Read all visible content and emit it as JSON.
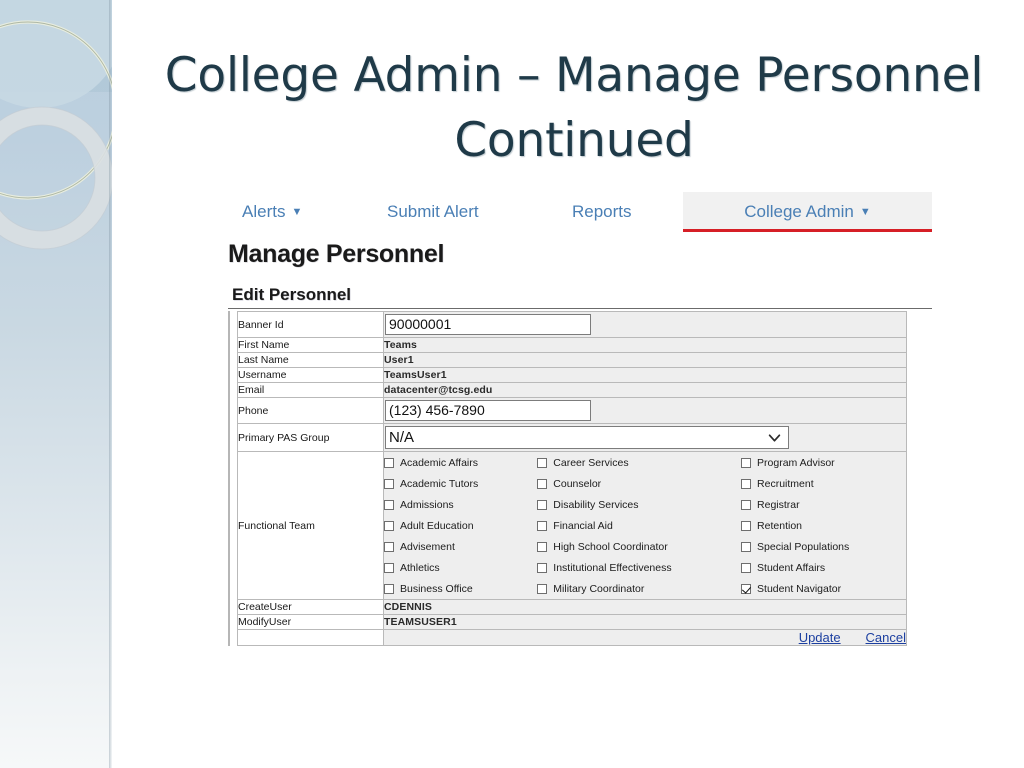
{
  "slide": {
    "title": "College Admin – Manage Personnel Continued"
  },
  "nav": {
    "items": [
      {
        "label": "Alerts",
        "has_caret": true,
        "active": false
      },
      {
        "label": "Submit Alert",
        "has_caret": false,
        "active": false
      },
      {
        "label": "Reports",
        "has_caret": false,
        "active": false
      },
      {
        "label": "College Admin",
        "has_caret": true,
        "active": true
      }
    ],
    "caret_glyph": "▼",
    "active_underline_color": "#d61f26",
    "link_color": "#4a7fb5"
  },
  "page": {
    "heading": "Manage Personnel"
  },
  "panel": {
    "header": "Edit Personnel",
    "fields": [
      {
        "label": "Banner Id",
        "value": "90000001",
        "type": "text"
      },
      {
        "label": "First Name",
        "value": "Teams",
        "type": "static"
      },
      {
        "label": "Last Name",
        "value": "User1",
        "type": "static"
      },
      {
        "label": "Username",
        "value": "TeamsUser1",
        "type": "static"
      },
      {
        "label": "Email",
        "value": "datacenter@tcsg.edu",
        "type": "static"
      },
      {
        "label": "Phone",
        "value": "(123) 456-7890",
        "type": "text"
      },
      {
        "label": "Primary PAS Group",
        "value": "N/A",
        "type": "select"
      }
    ],
    "functional_team": {
      "label": "Functional Team",
      "columns": [
        [
          {
            "label": "Academic Affairs",
            "checked": false
          },
          {
            "label": "Academic Tutors",
            "checked": false
          },
          {
            "label": "Admissions",
            "checked": false
          },
          {
            "label": "Adult Education",
            "checked": false
          },
          {
            "label": "Advisement",
            "checked": false
          },
          {
            "label": "Athletics",
            "checked": false
          },
          {
            "label": "Business Office",
            "checked": false
          }
        ],
        [
          {
            "label": "Career Services",
            "checked": false
          },
          {
            "label": "Counselor",
            "checked": false
          },
          {
            "label": "Disability Services",
            "checked": false
          },
          {
            "label": "Financial Aid",
            "checked": false
          },
          {
            "label": "High School Coordinator",
            "checked": false
          },
          {
            "label": "Institutional Effectiveness",
            "checked": false
          },
          {
            "label": "Military Coordinator",
            "checked": false
          }
        ],
        [
          {
            "label": "Program Advisor",
            "checked": false
          },
          {
            "label": "Recruitment",
            "checked": false
          },
          {
            "label": "Registrar",
            "checked": false
          },
          {
            "label": "Retention",
            "checked": false
          },
          {
            "label": "Special Populations",
            "checked": false
          },
          {
            "label": "Student Affairs",
            "checked": false
          },
          {
            "label": "Student Navigator",
            "checked": true
          }
        ]
      ]
    },
    "audit_fields": [
      {
        "label": "CreateUser",
        "value": "CDENNIS"
      },
      {
        "label": "ModifyUser",
        "value": "TEAMSUSER1"
      }
    ],
    "actions": [
      {
        "label": "Update"
      },
      {
        "label": "Cancel"
      }
    ],
    "link_color": "#1c3fa0"
  }
}
